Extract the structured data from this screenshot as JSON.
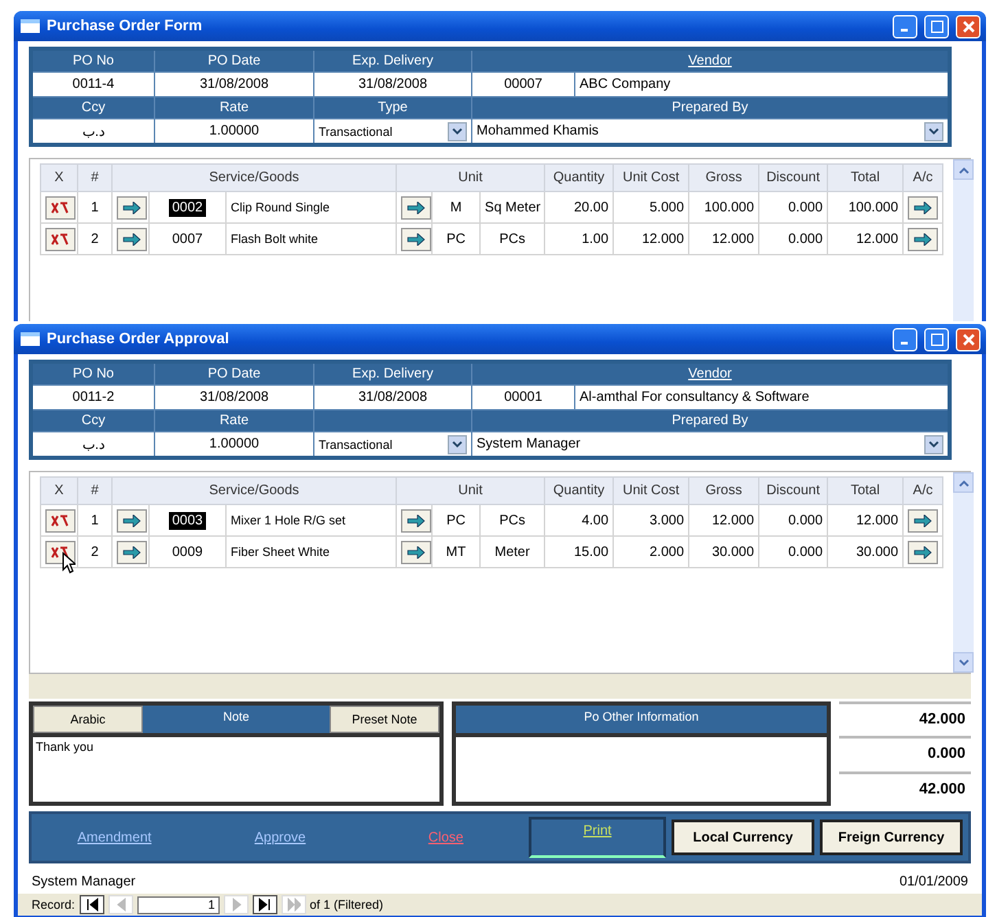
{
  "windows": [
    {
      "title": "Purchase Order Form",
      "header": {
        "labels": [
          "PO No",
          "PO Date",
          "Exp. Delivery",
          "Vendor"
        ],
        "po_no": "0011-4",
        "po_date": "31/08/2008",
        "exp_delivery": "31/08/2008",
        "vendor_code": "00007",
        "vendor_name": "ABC Company",
        "ccy_label": "Ccy",
        "rate_label": "Rate",
        "type_label": "Type",
        "prepared_by_label": "Prepared By",
        "ccy": "د.ب",
        "rate": "1.00000",
        "type": "Transactional",
        "prepared_by": "Mohammed Khamis"
      },
      "columns": [
        "X",
        "#",
        "Service/Goods",
        "Unit",
        "Quantity",
        "Unit Cost",
        "Gross",
        "Discount",
        "Total",
        "A/c"
      ],
      "rows": [
        {
          "num": "1",
          "code": "0002",
          "code_selected": true,
          "description": "Clip Round Single",
          "unit_code": "M",
          "unit_name": "Sq Meter",
          "quantity": "20.00",
          "unit_cost": "5.000",
          "gross": "100.000",
          "discount": "0.000",
          "total": "100.000"
        },
        {
          "num": "2",
          "code": "0007",
          "code_selected": false,
          "description": "Flash Bolt white",
          "unit_code": "PC",
          "unit_name": "PCs",
          "quantity": "1.00",
          "unit_cost": "12.000",
          "gross": "12.000",
          "discount": "0.000",
          "total": "12.000"
        }
      ]
    },
    {
      "title": "Purchase Order Approval",
      "header": {
        "labels": [
          "PO No",
          "PO Date",
          "Exp. Delivery",
          "Vendor"
        ],
        "po_no": "0011-2",
        "po_date": "31/08/2008",
        "exp_delivery": "31/08/2008",
        "vendor_code": "00001",
        "vendor_name": "Al-amthal For consultancy & Software",
        "ccy_label": "Ccy",
        "rate_label": "Rate",
        "prepared_by_label": "Prepared By",
        "ccy": "د.ب",
        "rate": "1.00000",
        "type": "Transactional",
        "prepared_by": "System Manager"
      },
      "columns": [
        "X",
        "#",
        "Service/Goods",
        "Unit",
        "Quantity",
        "Unit Cost",
        "Gross",
        "Discount",
        "Total",
        "A/c"
      ],
      "rows": [
        {
          "num": "1",
          "code": "0003",
          "code_selected": true,
          "description": "Mixer 1 Hole R/G set",
          "unit_code": "PC",
          "unit_name": "PCs",
          "quantity": "4.00",
          "unit_cost": "3.000",
          "gross": "12.000",
          "discount": "0.000",
          "total": "12.000"
        },
        {
          "num": "2",
          "code": "0009",
          "code_selected": false,
          "description": "Fiber Sheet White",
          "unit_code": "MT",
          "unit_name": "Meter",
          "quantity": "15.00",
          "unit_cost": "2.000",
          "gross": "30.000",
          "discount": "0.000",
          "total": "30.000"
        }
      ],
      "notes": {
        "arabic_button": "Arabic",
        "note_label": "Note",
        "preset_button": "Preset Note",
        "text": "Thank you"
      },
      "other_info": {
        "title": "Po Other Information"
      },
      "totals": [
        "42.000",
        "0.000",
        "42.000"
      ],
      "actions": [
        {
          "kind": "link",
          "label": "Amendment",
          "color": "#a8c8ff"
        },
        {
          "kind": "link",
          "label": "Approve",
          "color": "#a8c8ff"
        },
        {
          "kind": "link",
          "label": "Close",
          "color": "#ff6070"
        },
        {
          "kind": "boxed-link",
          "label": "Print",
          "color": "#c8e060"
        },
        {
          "kind": "button",
          "label": "Local Currency"
        },
        {
          "kind": "button",
          "label": "Freign Currency"
        }
      ],
      "status": {
        "user": "System Manager",
        "date": "01/01/2009"
      },
      "record_nav": {
        "label": "Record:",
        "current": "1",
        "total": "of 1 (Filtered)",
        "buttons": [
          {
            "kind": "first",
            "disabled": false
          },
          {
            "kind": "prev",
            "disabled": true
          },
          {
            "kind": "next",
            "disabled": true
          },
          {
            "kind": "last",
            "disabled": false
          },
          {
            "kind": "new",
            "disabled": true
          }
        ]
      }
    }
  ]
}
